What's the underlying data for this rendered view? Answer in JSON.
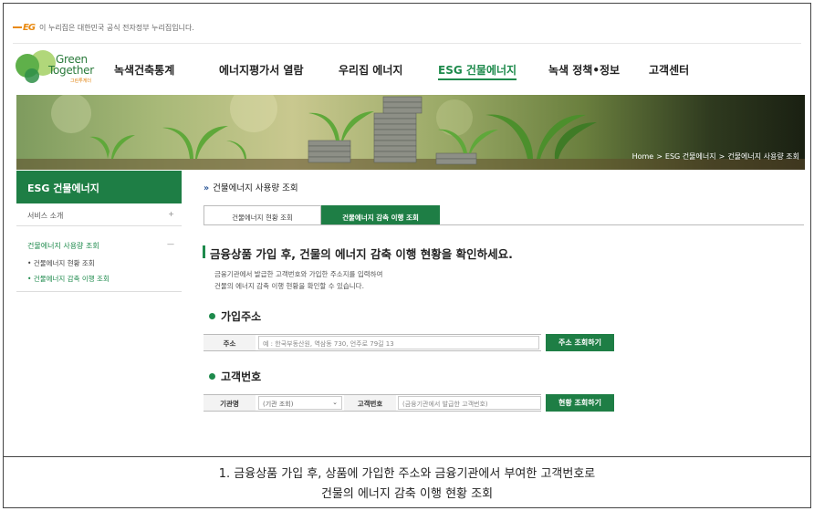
{
  "gov_banner": {
    "logo": "EG",
    "text": "이 누리집은 대한민국 공식 전자정부 누리집입니다."
  },
  "logo": {
    "line1": "Green",
    "line2": "Together",
    "sub": "그린투게더"
  },
  "gnb": [
    {
      "label": "녹색건축통계",
      "active": false
    },
    {
      "label": "에너지평가서 열람",
      "active": false
    },
    {
      "label": "우리집 에너지",
      "active": false
    },
    {
      "label": "ESG 건물에너지",
      "active": true
    },
    {
      "label": "녹색 정책•정보",
      "active": false
    },
    {
      "label": "고객센터",
      "active": false
    }
  ],
  "breadcrumb": [
    "Home",
    "ESG 건물에너지",
    "건물에너지 사용량 조회"
  ],
  "breadcrumb_sep": ">",
  "sidebar": {
    "title": "ESG 건물에너지",
    "items": [
      {
        "label": "서비스 소개",
        "mark": "+"
      },
      {
        "label": "건물에너지 사용량 조회",
        "mark": "—"
      }
    ],
    "subitems": [
      {
        "label": "• 건물에너지 현황 조회",
        "active": false
      },
      {
        "label": "• 건물에너지 감축 이행 조회",
        "active": true
      }
    ]
  },
  "page_title": {
    "arrows": "»",
    "text": "건물에너지 사용량 조회"
  },
  "tabs": [
    {
      "label": "건물에너지 현황 조회",
      "active": false
    },
    {
      "label": "건물에너지 감축 이행 조회",
      "active": true
    }
  ],
  "heading": "금융상품 가입 후, 건물의 에너지 감축 이행 현황을 확인하세요.",
  "description": [
    "금융기관에서 발급한 고객번호와 가입한 주소지를 입력하여",
    "건물의 에너지 감축 이행 현황을 확인할 수 있습니다."
  ],
  "address_section": {
    "title": "가입주소",
    "label": "주소",
    "placeholder": "예 : 한국부동산원, 역삼동 730, 언주로 79길 13",
    "button": "주소 조회하기"
  },
  "customer_section": {
    "title": "고객번호",
    "org_label": "기관명",
    "org_select": "(기관 조회)",
    "org_caret": "⌄",
    "num_label": "고객번호",
    "num_placeholder": "(금융기관에서 발급한 고객번호)",
    "button": "현황 조회하기"
  },
  "caption": {
    "line1": "1. 금융상품 가입 후, 상품에 가입한 주소와 금융기관에서 부여한 고객번호로",
    "line2": "건물의 에너지 감축 이행 현황 조회"
  },
  "colors": {
    "accent": "#1e7e45",
    "active_link": "#1e8a4c",
    "gov_logo": "#e98a12"
  }
}
